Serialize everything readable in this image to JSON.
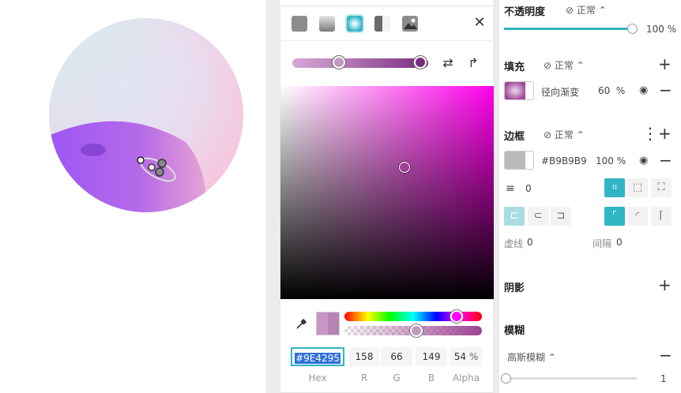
{
  "picker": {
    "close_glyph": "✕",
    "fill_types": [
      {
        "name": "solid-fill",
        "color": "#8c8c8c"
      },
      {
        "name": "linear-gradient",
        "color": "#9a9a9a"
      },
      {
        "name": "radial-gradient",
        "color": "#2fb5c4"
      },
      {
        "name": "angular-gradient",
        "color": "#7a7a7a"
      },
      {
        "name": "image-fill",
        "color": "#8c8c8c"
      }
    ],
    "hex": "#9E4295",
    "r": "158",
    "g": "66",
    "b": "149",
    "alpha": "54",
    "alpha_unit": "%",
    "labels": {
      "hex": "Hex",
      "r": "R",
      "g": "G",
      "b": "B",
      "alpha": "Alpha"
    },
    "hue_position": 0.83,
    "alpha_position": 0.54
  },
  "panel": {
    "opacity": {
      "title": "不透明度",
      "blend": "正常",
      "value": "100",
      "unit": "%"
    },
    "fill": {
      "title": "填充",
      "blend": "正常",
      "type": "径向渐变",
      "opacity": "60",
      "unit": "%"
    },
    "stroke": {
      "title": "边框",
      "blend": "正常",
      "color": "#B9B9B9",
      "opacity": "100",
      "unit": "%",
      "width": "0",
      "dash_label": "虚线",
      "dash_value": "0",
      "gap_label": "间隔",
      "gap_value": "0"
    },
    "shadow": {
      "title": "阴影"
    },
    "blur": {
      "title": "模糊",
      "type": "高斯模糊",
      "value": "1"
    }
  },
  "colors": {
    "accent": "#2fb5c4",
    "fill_swatch": "#9E4295",
    "stroke_swatch": "#B9B9B9"
  }
}
